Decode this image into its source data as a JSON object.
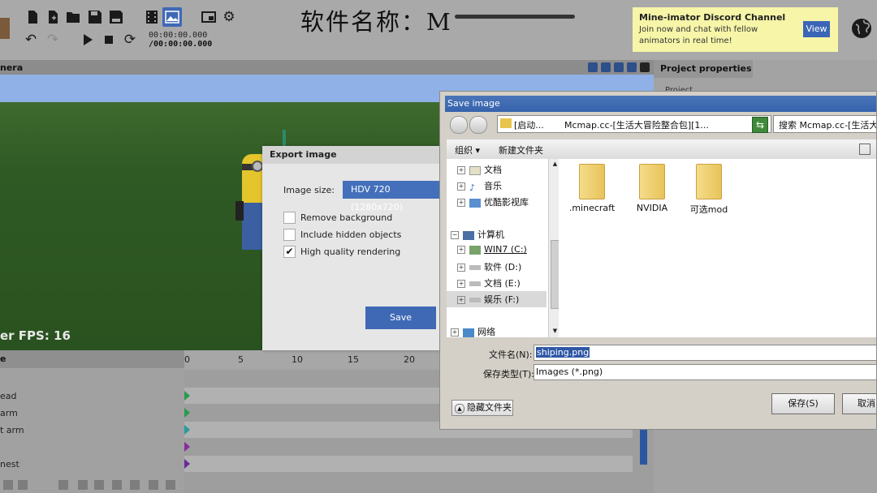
{
  "toolbar": {
    "time_current": "00:00:00.000",
    "time_total": "/00:00:00.000",
    "icons": [
      "new-file-icon",
      "new-scene-icon",
      "open-folder-icon",
      "save-icon",
      "save-as-icon",
      "render-video-icon",
      "render-image-icon",
      "window-icon",
      "settings-icon",
      "undo-icon",
      "redo-icon",
      "play-icon",
      "stop-icon",
      "loop-icon",
      "crafting-table-icon"
    ]
  },
  "overlay_caption": "软件名称：M",
  "discord": {
    "title": "Mine-imator Discord Channel",
    "text": "Join now and chat with fellow animators in real time!",
    "button": "View"
  },
  "camera": {
    "header": "nera",
    "fps": "er FPS: 16"
  },
  "timeline": {
    "header": "e",
    "ruler": [
      "0",
      "5",
      "10",
      "15",
      "20"
    ],
    "rows": [
      "ead",
      "arm",
      "t arm",
      "",
      "nest"
    ],
    "keyframe_colors": [
      "#2a9b4a",
      "#2a9b4a",
      "#2a9b9b",
      "#8a2a9b",
      "#6a2a9b"
    ]
  },
  "properties": {
    "tab": "Project properties",
    "item": "Project"
  },
  "export": {
    "title": "Export image",
    "size_label": "Image size:",
    "size_value": "HDV 720 (1280x720)",
    "options": [
      {
        "label": "Remove background",
        "checked": ""
      },
      {
        "label": "Include hidden objects",
        "checked": ""
      },
      {
        "label": "High quality rendering",
        "checked": "✔"
      }
    ],
    "save": "Save"
  },
  "save_dialog": {
    "title": "Save image",
    "address_prefix": "[启动...",
    "address_path": "Mcmap.cc-[生活大冒险整合包][1...",
    "search_placeholder": "搜索 Mcmap.cc-[生活大冒",
    "organize": "组织",
    "new_folder": "新建文件夹",
    "tree": {
      "libraries": [
        "文档",
        "音乐",
        "优酷影视库"
      ],
      "computer": "计算机",
      "drives": [
        "WIN7 (C:)",
        "软件 (D:)",
        "文档 (E:)",
        "娱乐 (F:)"
      ],
      "network": "网络"
    },
    "folders": [
      ".minecraft",
      "NVIDIA",
      "可选mod"
    ],
    "filename_label": "文件名(N):",
    "filename_value": "shiping.png",
    "filetype_label": "保存类型(T):",
    "filetype_value": "Images (*.png)",
    "hide_folders": "隐藏文件夹",
    "save_button": "保存(S)",
    "cancel_button": "取消"
  }
}
